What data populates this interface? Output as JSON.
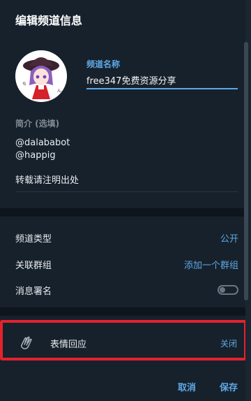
{
  "dialog": {
    "title": "编辑频道信息",
    "name_label": "频道名称",
    "name_value": "free347免费资源分享",
    "desc_label": "简介 (选填)",
    "desc_text": "@dalababot\n@happig\n\n转载请注明出处"
  },
  "settings": {
    "channel_type_label": "频道类型",
    "channel_type_value": "公开",
    "linked_group_label": "关联群组",
    "linked_group_value": "添加一个群组",
    "sign_messages_label": "消息署名",
    "sign_messages_enabled": false
  },
  "reactions": {
    "icon": "clapping-hands-icon",
    "label": "表情回应",
    "value": "关闭"
  },
  "footer": {
    "cancel_label": "取消",
    "save_label": "保存"
  },
  "colors": {
    "accent": "#5ea8e6",
    "background": "#17212b",
    "highlight_border": "#e3222d"
  }
}
